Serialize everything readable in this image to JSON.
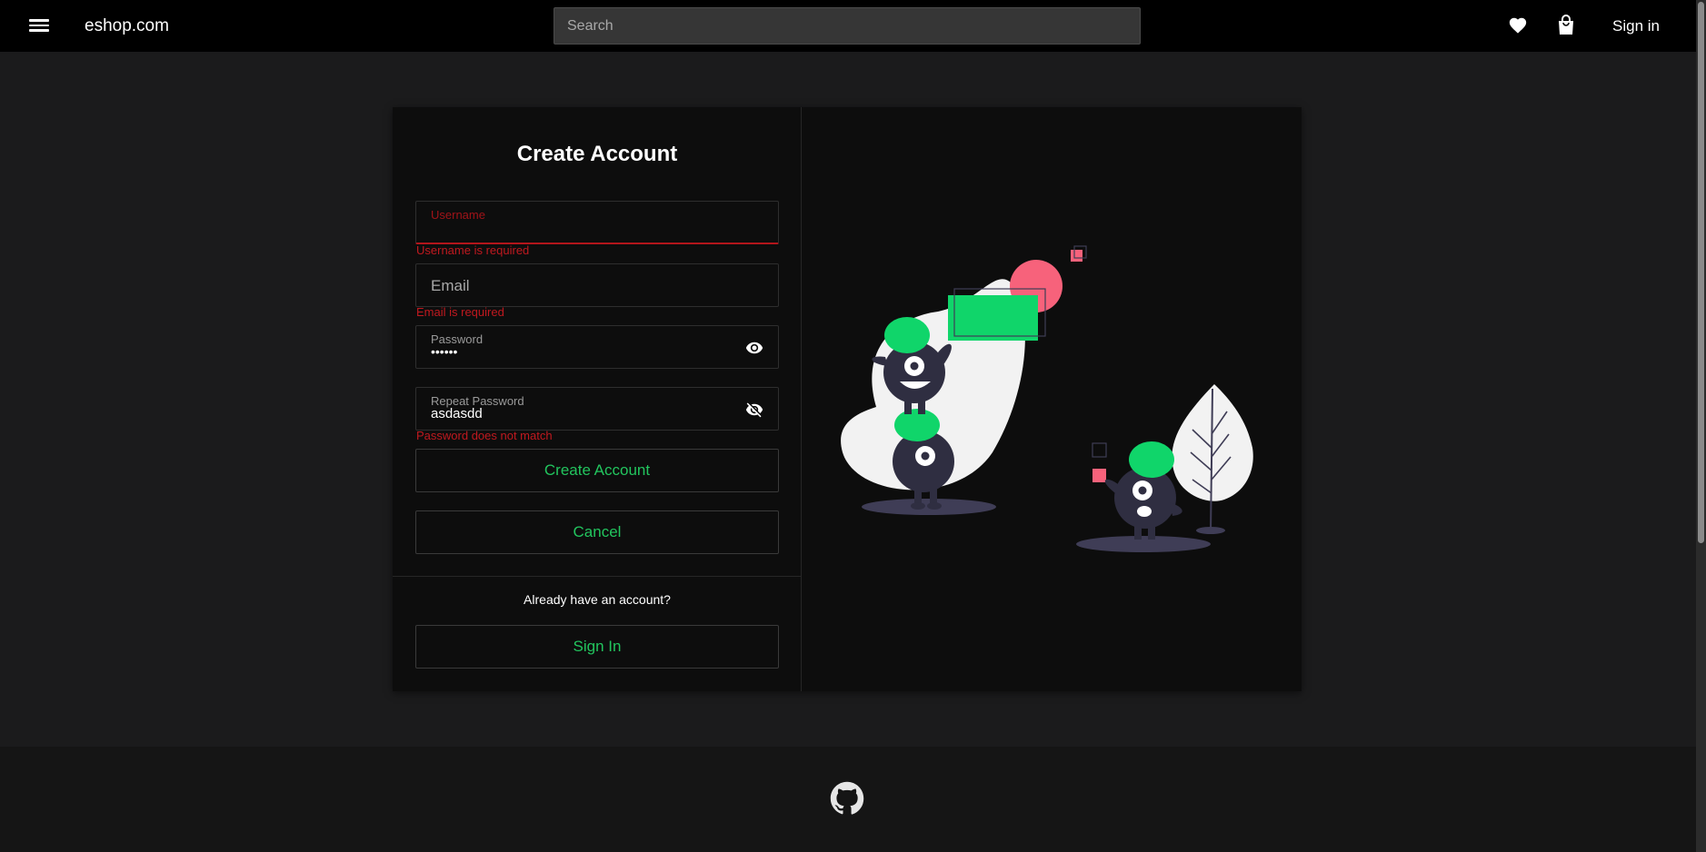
{
  "header": {
    "brand": "eshop.com",
    "search_placeholder": "Search",
    "signin_label": "Sign in",
    "icons": [
      "menu-icon",
      "heart-icon",
      "shopping-bag-icon"
    ]
  },
  "form": {
    "title": "Create Account",
    "username": {
      "label": "Username",
      "value": "",
      "error": "Username is required"
    },
    "email": {
      "label": "Email",
      "value": "",
      "error": "Email is required"
    },
    "password": {
      "label": "Password",
      "value": "••••••"
    },
    "repeat_password": {
      "label": "Repeat Password",
      "value": "asdasdd",
      "error": "Password does not match"
    },
    "create_button": "Create Account",
    "cancel_button": "Cancel",
    "already_text": "Already have an account?",
    "signin_button": "Sign In"
  },
  "colors": {
    "accent": "#22c55e",
    "error": "#c0191f",
    "illustration_green": "#10d56a",
    "illustration_pink": "#f7627b",
    "illustration_dark": "#2f2e41"
  },
  "footer": {
    "icon": "github-icon"
  }
}
